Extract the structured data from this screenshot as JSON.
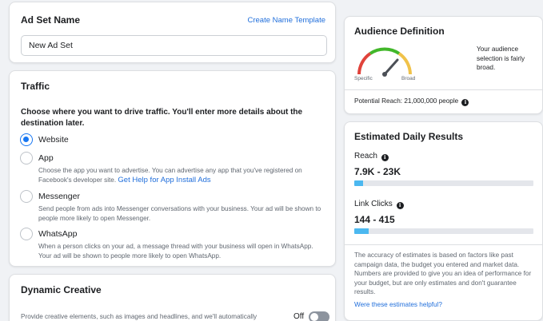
{
  "ad_set": {
    "title": "Ad Set Name",
    "create_template_link": "Create Name Template",
    "name_value": "New Ad Set"
  },
  "traffic": {
    "title": "Traffic",
    "description": "Choose where you want to drive traffic. You'll enter more details about the destination later.",
    "selected": "Website",
    "options": [
      {
        "label": "Website",
        "help": ""
      },
      {
        "label": "App",
        "help": "Choose the app you want to advertise. You can advertise any app that you've registered on Facebook's developer site.",
        "help_link": "Get Help for App Install Ads"
      },
      {
        "label": "Messenger",
        "help": "Send people from ads into Messenger conversations with your business. Your ad will be shown to people more likely to open Messenger."
      },
      {
        "label": "WhatsApp",
        "help": "When a person clicks on your ad, a message thread with your business will open in WhatsApp. Your ad will be shown to people more likely to open WhatsApp."
      }
    ]
  },
  "dynamic_creative": {
    "title": "Dynamic Creative",
    "description": "Provide creative elements, such as images and headlines, and we'll automatically",
    "toggle_label": "Off",
    "toggle_on": false
  },
  "audience": {
    "title": "Audience Definition",
    "gauge_left": "Specific",
    "gauge_right": "Broad",
    "note": "Your audience selection is fairly broad.",
    "potential_reach": "Potential Reach: 21,000,000 people",
    "info_icon": "info-icon"
  },
  "estimates": {
    "title": "Estimated Daily Results",
    "reach_label": "Reach",
    "reach_value": "7.9K - 23K",
    "reach_fill_fraction": 0.05,
    "clicks_label": "Link Clicks",
    "clicks_value": "144 - 415",
    "clicks_fill_fraction": 0.08,
    "note": "The accuracy of estimates is based on factors like past campaign data, the budget you entered and market data. Numbers are provided to give you an idea of performance for your budget, but are only estimates and don't guarantee results.",
    "helpful_link": "Were these estimates helpful?"
  },
  "colors": {
    "accent": "#1877f2",
    "link": "#216fdb",
    "bar_fill": "#4cb8f0",
    "gauge_red": "#e0433b",
    "gauge_green": "#42b72a",
    "gauge_yellow": "#f0c24a"
  }
}
